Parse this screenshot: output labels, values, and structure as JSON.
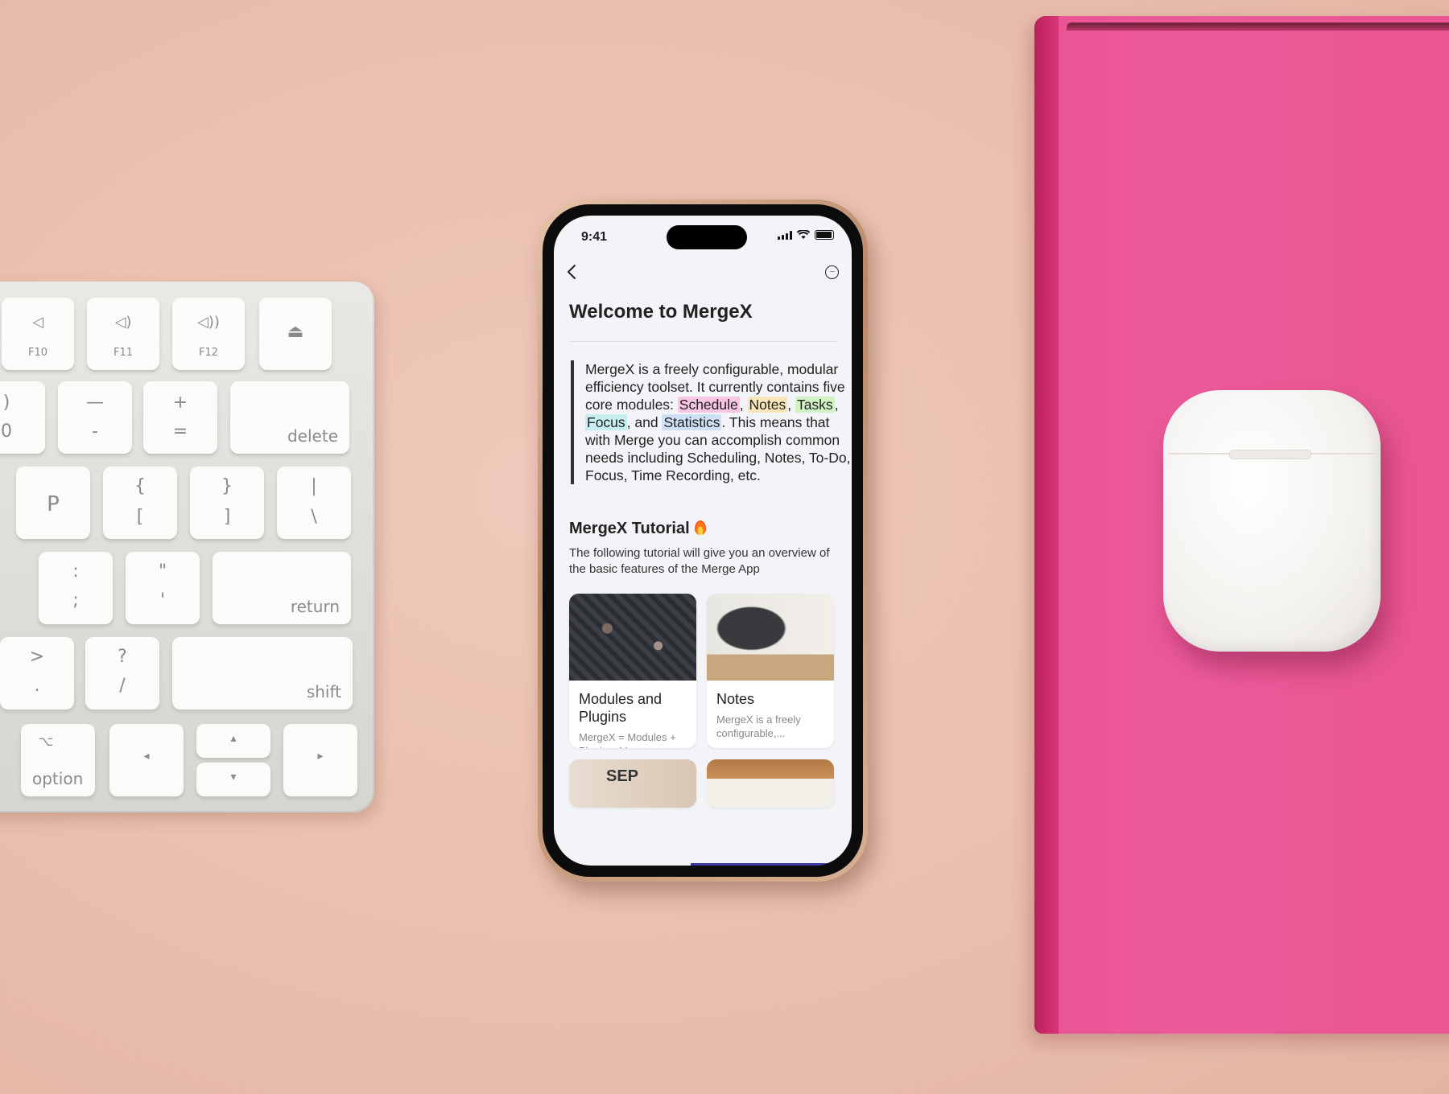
{
  "keyboard": {
    "keys": {
      "f10": "F10",
      "f11": "F11",
      "f12": "F12",
      "eject": "⏏",
      "zero_top": ")",
      "zero_bottom": "0",
      "minus_top": "—",
      "minus_bottom": "-",
      "plus_top": "+",
      "plus_bottom": "=",
      "delete": "delete",
      "p": "P",
      "lbrace_top": "{",
      "lbrace_bottom": "[",
      "rbrace_top": "}",
      "rbrace_bottom": "]",
      "pipe_top": "|",
      "pipe_bottom": "\\",
      "colon_top": ":",
      "colon_bottom": ";",
      "quote_top": "\"",
      "quote_bottom": "'",
      "return": "return",
      "gt_top": ">",
      "gt_bottom": ".",
      "question_top": "?",
      "question_bottom": "/",
      "shift": "shift",
      "option_symbol": "⌥",
      "option": "option",
      "left": "◂",
      "up": "▴",
      "down": "▾",
      "right": "▸"
    }
  },
  "status_bar": {
    "time": "9:41"
  },
  "nav": {
    "back_icon": "chevron-left",
    "more_icon": "ellipsis-circle",
    "more_glyph": "···"
  },
  "page": {
    "title": "Welcome to MergeX",
    "intro": {
      "p1": "MergeX is a freely configurable, modular efficiency toolset. It currently contains five core modules: ",
      "modules": [
        "Schedule",
        "Notes",
        "Tasks",
        "Focus",
        "Statistics"
      ],
      "sep_comma": ", ",
      "and": ", and ",
      "p2": ". This means that with Merge you can accomplish common needs including Scheduling, Notes, To-Do, Focus, Time Recording, etc."
    },
    "highlight_colors": {
      "Schedule": "#f6c6e3",
      "Notes": "#f7e6b9",
      "Tasks": "#d2f2c4",
      "Focus": "#c6eef0",
      "Statistics": "#cde0f6"
    },
    "tutorial_title": "MergeX Tutorial",
    "tutorial_icon": "fire-icon",
    "tutorial_desc": "The following tutorial will give you an overview of the basic features of the Merge App",
    "cards": [
      {
        "title": "Modules and Plugins",
        "desc": "MergeX = Modules + Plugins, Merge..."
      },
      {
        "title": "Notes",
        "desc": "MergeX is a freely configurable,..."
      },
      {
        "title": "",
        "desc": "",
        "image_text": "SEP"
      },
      {
        "title": "",
        "desc": ""
      }
    ]
  }
}
